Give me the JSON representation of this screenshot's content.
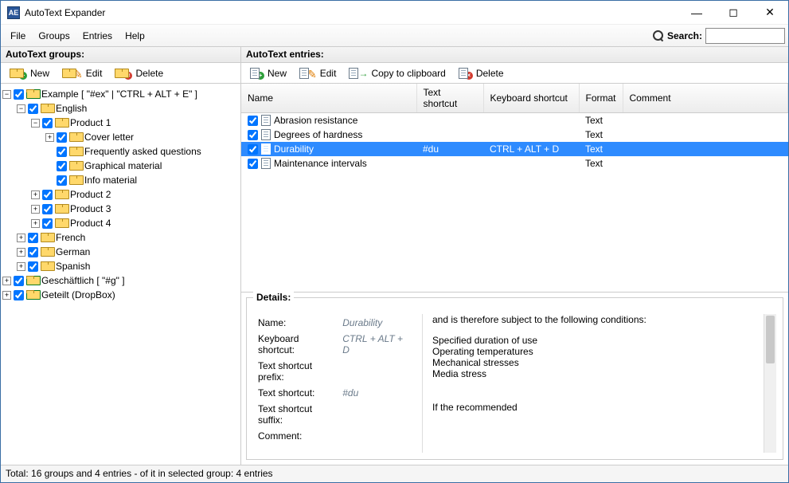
{
  "window": {
    "title": "AutoText Expander"
  },
  "menu": {
    "file": "File",
    "groups": "Groups",
    "entries": "Entries",
    "help": "Help",
    "search_label": "Search:",
    "search_value": ""
  },
  "panel_labels": {
    "groups": "AutoText groups:",
    "entries": "AutoText entries:"
  },
  "groups_toolbar": {
    "new": "New",
    "edit": "Edit",
    "delete": "Delete"
  },
  "entries_toolbar": {
    "new": "New",
    "edit": "Edit",
    "copy": "Copy to clipboard",
    "delete": "Delete"
  },
  "tree": {
    "example": "Example [ \"#ex\" | \"CTRL + ALT + E\" ]",
    "english": "English",
    "product1": "Product 1",
    "cover_letter": "Cover letter",
    "faq": "Frequently asked questions",
    "graphical": "Graphical material",
    "info": "Info material",
    "product2": "Product 2",
    "product3": "Product 3",
    "product4": "Product 4",
    "french": "French",
    "german": "German",
    "spanish": "Spanish",
    "geschaeftlich": "Geschäftlich [ \"#g\" ]",
    "geteilt": "Geteilt (DropBox)"
  },
  "columns": {
    "name": "Name",
    "text_shortcut": "Text shortcut",
    "keyboard_shortcut": "Keyboard shortcut",
    "format": "Format",
    "comment": "Comment"
  },
  "entries": [
    {
      "name": "Abrasion resistance",
      "text_shortcut": "",
      "keyboard_shortcut": "",
      "format": "Text",
      "comment": ""
    },
    {
      "name": "Degrees of hardness",
      "text_shortcut": "",
      "keyboard_shortcut": "",
      "format": "Text",
      "comment": ""
    },
    {
      "name": "Durability",
      "text_shortcut": "#du",
      "keyboard_shortcut": "CTRL + ALT + D",
      "format": "Text",
      "comment": ""
    },
    {
      "name": "Maintenance intervals",
      "text_shortcut": "",
      "keyboard_shortcut": "",
      "format": "Text",
      "comment": ""
    }
  ],
  "details": {
    "legend": "Details:",
    "name_label": "Name:",
    "name_value": "Durability",
    "kbd_label": "Keyboard shortcut:",
    "kbd_value": "CTRL + ALT + D",
    "prefix_label": "Text shortcut prefix:",
    "prefix_value": "",
    "short_label": "Text shortcut:",
    "short_value": "#du",
    "suffix_label": "Text shortcut suffix:",
    "suffix_value": "",
    "comment_label": "Comment:",
    "comment_value": "",
    "preview_l1": "and is therefore subject to the following conditions:",
    "preview_l2": "Specified duration of use",
    "preview_l3": "Operating temperatures",
    "preview_l4": "Mechanical stresses",
    "preview_l5": "Media stress",
    "preview_l6": "If the recommended"
  },
  "status": "Total: 16 groups and 4 entries - of it in selected group: 4 entries"
}
